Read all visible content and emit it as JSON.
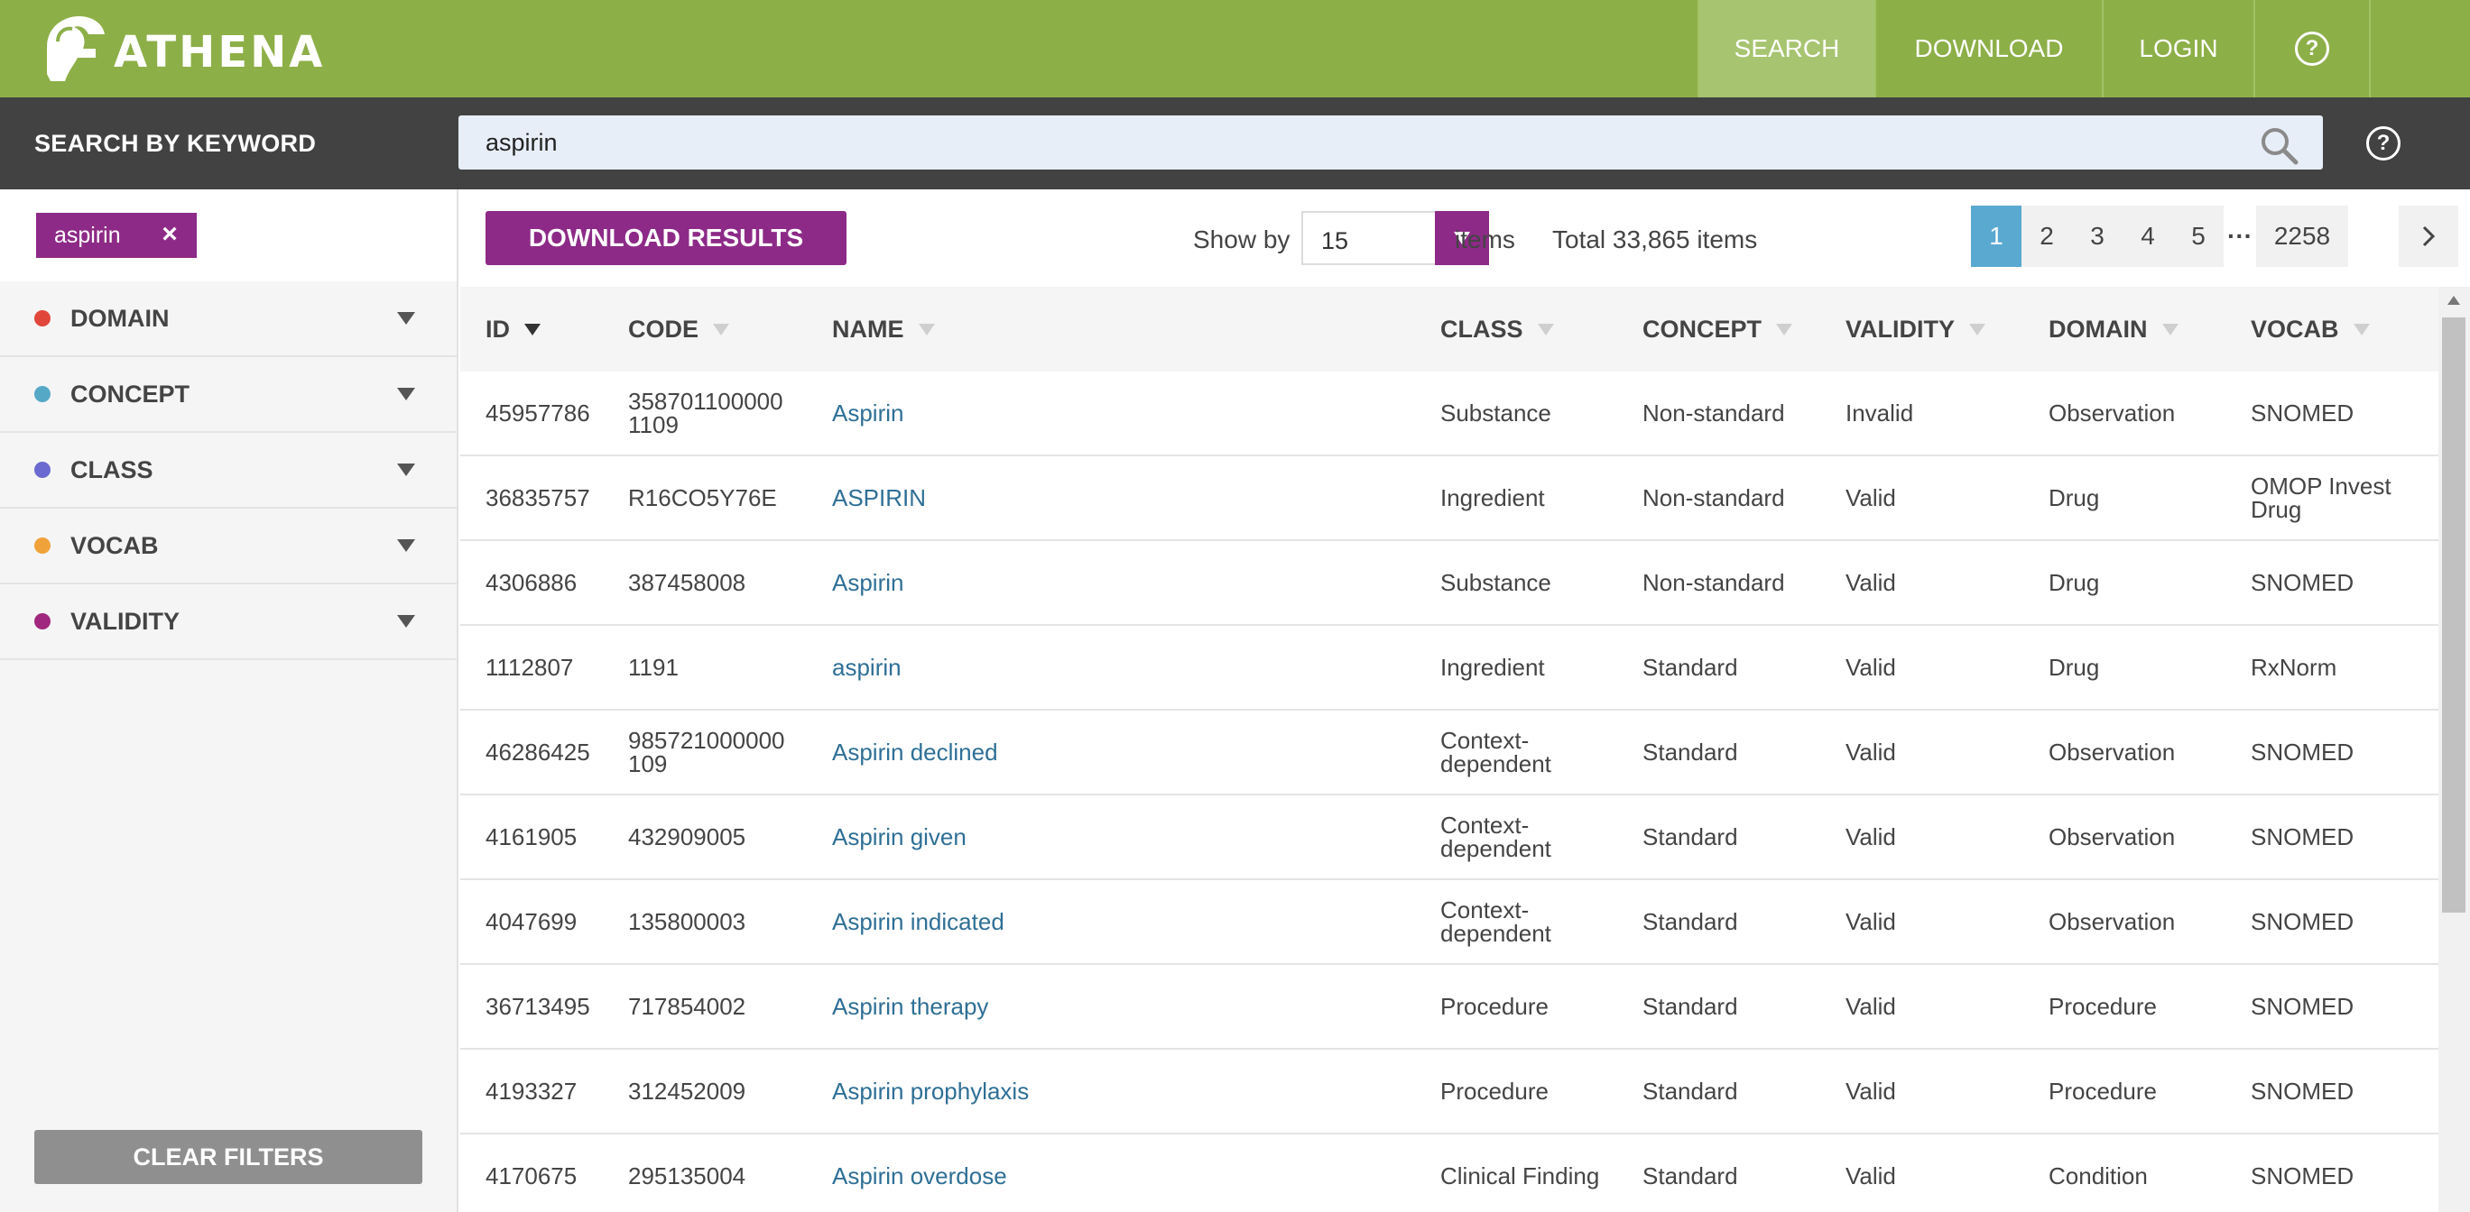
{
  "app": {
    "name": "ATHENA"
  },
  "nav": {
    "search": "SEARCH",
    "download": "DOWNLOAD",
    "login": "LOGIN",
    "help": "?"
  },
  "search": {
    "label": "SEARCH BY KEYWORD",
    "value": "aspirin",
    "help": "?"
  },
  "filters": {
    "chip": {
      "label": "aspirin",
      "remove": "×"
    },
    "facets": [
      {
        "label": "DOMAIN",
        "color": "#e0473a"
      },
      {
        "label": "CONCEPT",
        "color": "#56a8c7"
      },
      {
        "label": "CLASS",
        "color": "#6a6ad0"
      },
      {
        "label": "VOCAB",
        "color": "#f0a23a"
      },
      {
        "label": "VALIDITY",
        "color": "#a0287e"
      }
    ],
    "clear_label": "CLEAR FILTERS"
  },
  "toolbar": {
    "download_label": "DOWNLOAD RESULTS",
    "show_by_label": "Show by",
    "show_by_value": "15",
    "items_label": "items",
    "total_label": "Total 33,865 items"
  },
  "pagination": {
    "pages": [
      "1",
      "2",
      "3",
      "4",
      "5"
    ],
    "ellipsis": "···",
    "last": "2258",
    "current": "1"
  },
  "table": {
    "columns": [
      "ID",
      "CODE",
      "NAME",
      "CLASS",
      "CONCEPT",
      "VALIDITY",
      "DOMAIN",
      "VOCAB"
    ],
    "rows": [
      {
        "id": "45957786",
        "code": "358701100000 1109",
        "name": "Aspirin",
        "class": "Substance",
        "concept": "Non-standard",
        "validity": "Invalid",
        "domain": "Observation",
        "vocab": "SNOMED"
      },
      {
        "id": "36835757",
        "code": "R16CO5Y76E",
        "name": "ASPIRIN",
        "class": "Ingredient",
        "concept": "Non-standard",
        "validity": "Valid",
        "domain": "Drug",
        "vocab": "OMOP Invest Drug"
      },
      {
        "id": "4306886",
        "code": "387458008",
        "name": "Aspirin",
        "class": "Substance",
        "concept": "Non-standard",
        "validity": "Valid",
        "domain": "Drug",
        "vocab": "SNOMED"
      },
      {
        "id": "1112807",
        "code": "1191",
        "name": "aspirin",
        "class": "Ingredient",
        "concept": "Standard",
        "validity": "Valid",
        "domain": "Drug",
        "vocab": "RxNorm"
      },
      {
        "id": "46286425",
        "code": "985721000000 109",
        "name": "Aspirin declined",
        "class": "Context-dependent",
        "concept": "Standard",
        "validity": "Valid",
        "domain": "Observation",
        "vocab": "SNOMED"
      },
      {
        "id": "4161905",
        "code": "432909005",
        "name": "Aspirin given",
        "class": "Context-dependent",
        "concept": "Standard",
        "validity": "Valid",
        "domain": "Observation",
        "vocab": "SNOMED"
      },
      {
        "id": "4047699",
        "code": "135800003",
        "name": "Aspirin indicated",
        "class": "Context-dependent",
        "concept": "Standard",
        "validity": "Valid",
        "domain": "Observation",
        "vocab": "SNOMED"
      },
      {
        "id": "36713495",
        "code": "717854002",
        "name": "Aspirin therapy",
        "class": "Procedure",
        "concept": "Standard",
        "validity": "Valid",
        "domain": "Procedure",
        "vocab": "SNOMED"
      },
      {
        "id": "4193327",
        "code": "312452009",
        "name": "Aspirin prophylaxis",
        "class": "Procedure",
        "concept": "Standard",
        "validity": "Valid",
        "domain": "Procedure",
        "vocab": "SNOMED"
      },
      {
        "id": "4170675",
        "code": "295135004",
        "name": "Aspirin overdose",
        "class": "Clinical Finding",
        "concept": "Standard",
        "validity": "Valid",
        "domain": "Condition",
        "vocab": "SNOMED"
      }
    ]
  }
}
